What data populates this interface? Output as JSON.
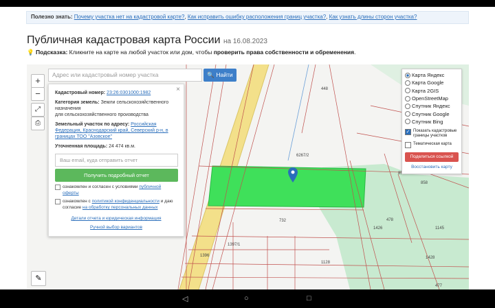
{
  "infobar": {
    "prefix": "Полезно знать:",
    "link1": "Почему участка нет на кадастровой карте?",
    "link2": "Как исправить ошибку расположения границ участка?",
    "link3": "Как узнать длины сторон участка?"
  },
  "header": {
    "title": "Публичная кадастровая карта России",
    "date": "на 16.08.2023"
  },
  "hint": {
    "label": "Подсказка:",
    "text": "Кликните на карте на любой участок или дом, чтобы",
    "bold": "проверить права собственности и обременения",
    "end": "."
  },
  "search": {
    "placeholder": "Адрес или кадастровый номер участка",
    "button": "Найти",
    "button_icon": "search-icon"
  },
  "zoom": {
    "in": "+",
    "out": "−"
  },
  "card": {
    "cad_label": "Кадастровый номер:",
    "cad_value": "23:26:0301000:1982",
    "cat_label": "Категория земель:",
    "cat_value": "Земли сельскохозяйственного назначения",
    "purpose": "для сельскохозяйственного производства",
    "addr_label": "Земельный участок по адресу:",
    "addr_value": "Российская Федерация, Краснодарский край, Северский р-н, в границах ТОО \"Азовское\"",
    "area_label": "Уточненная площадь:",
    "area_value": "24 474 кв.м.",
    "email_placeholder": "Ваш email, куда отправить отчет",
    "report_button": "Получить подробный отчет",
    "agree1_text": "ознакомлен и согласен с условиями",
    "agree1_link": "публичной оферты",
    "agree2_text": "ознакомлен с",
    "agree2_link1": "политикой конфиденциальности",
    "agree2_mid": "и даю согласие",
    "agree2_link2": "на обработку персональных данных",
    "details_link": "Детали отчета и юридическая информация",
    "manual_link": "Ручной выбор вариантов",
    "close": "×"
  },
  "layers": {
    "options": [
      {
        "label": "Карта Яндекс",
        "selected": true
      },
      {
        "label": "Карта Google",
        "selected": false
      },
      {
        "label": "Карта 2GIS",
        "selected": false
      },
      {
        "label": "OpenStreetMap",
        "selected": false
      },
      {
        "label": "Спутник Яндекс",
        "selected": false
      },
      {
        "label": "Спутник Google",
        "selected": false
      },
      {
        "label": "Спутник Bing",
        "selected": false
      }
    ],
    "show_borders": "Показать кадастровые границы участков",
    "show_borders_checked": true,
    "thematic": "Тематическая карта",
    "thematic_checked": false,
    "share_button": "Поделиться ссылкой",
    "restore_link": "Восстановить карту"
  },
  "map_labels": {
    "l448": "448",
    "l6267": "6267/2",
    "l858a": "858",
    "l858b": "858",
    "l732": "732",
    "l1145": "1145",
    "l1397": "1397/1",
    "l1396": "1396",
    "l1128": "1128",
    "l1428": "1428",
    "l477": "477",
    "l478": "478",
    "l1426": "1426"
  },
  "colors": {
    "parcel_highlight": "#3fe05a",
    "forest": "#c8ead0",
    "road": "#f3e08a",
    "boundary": "#c0504d",
    "accent": "#3d7fc9"
  },
  "navbar": {
    "back": "◁",
    "home": "○",
    "recents": "□"
  }
}
